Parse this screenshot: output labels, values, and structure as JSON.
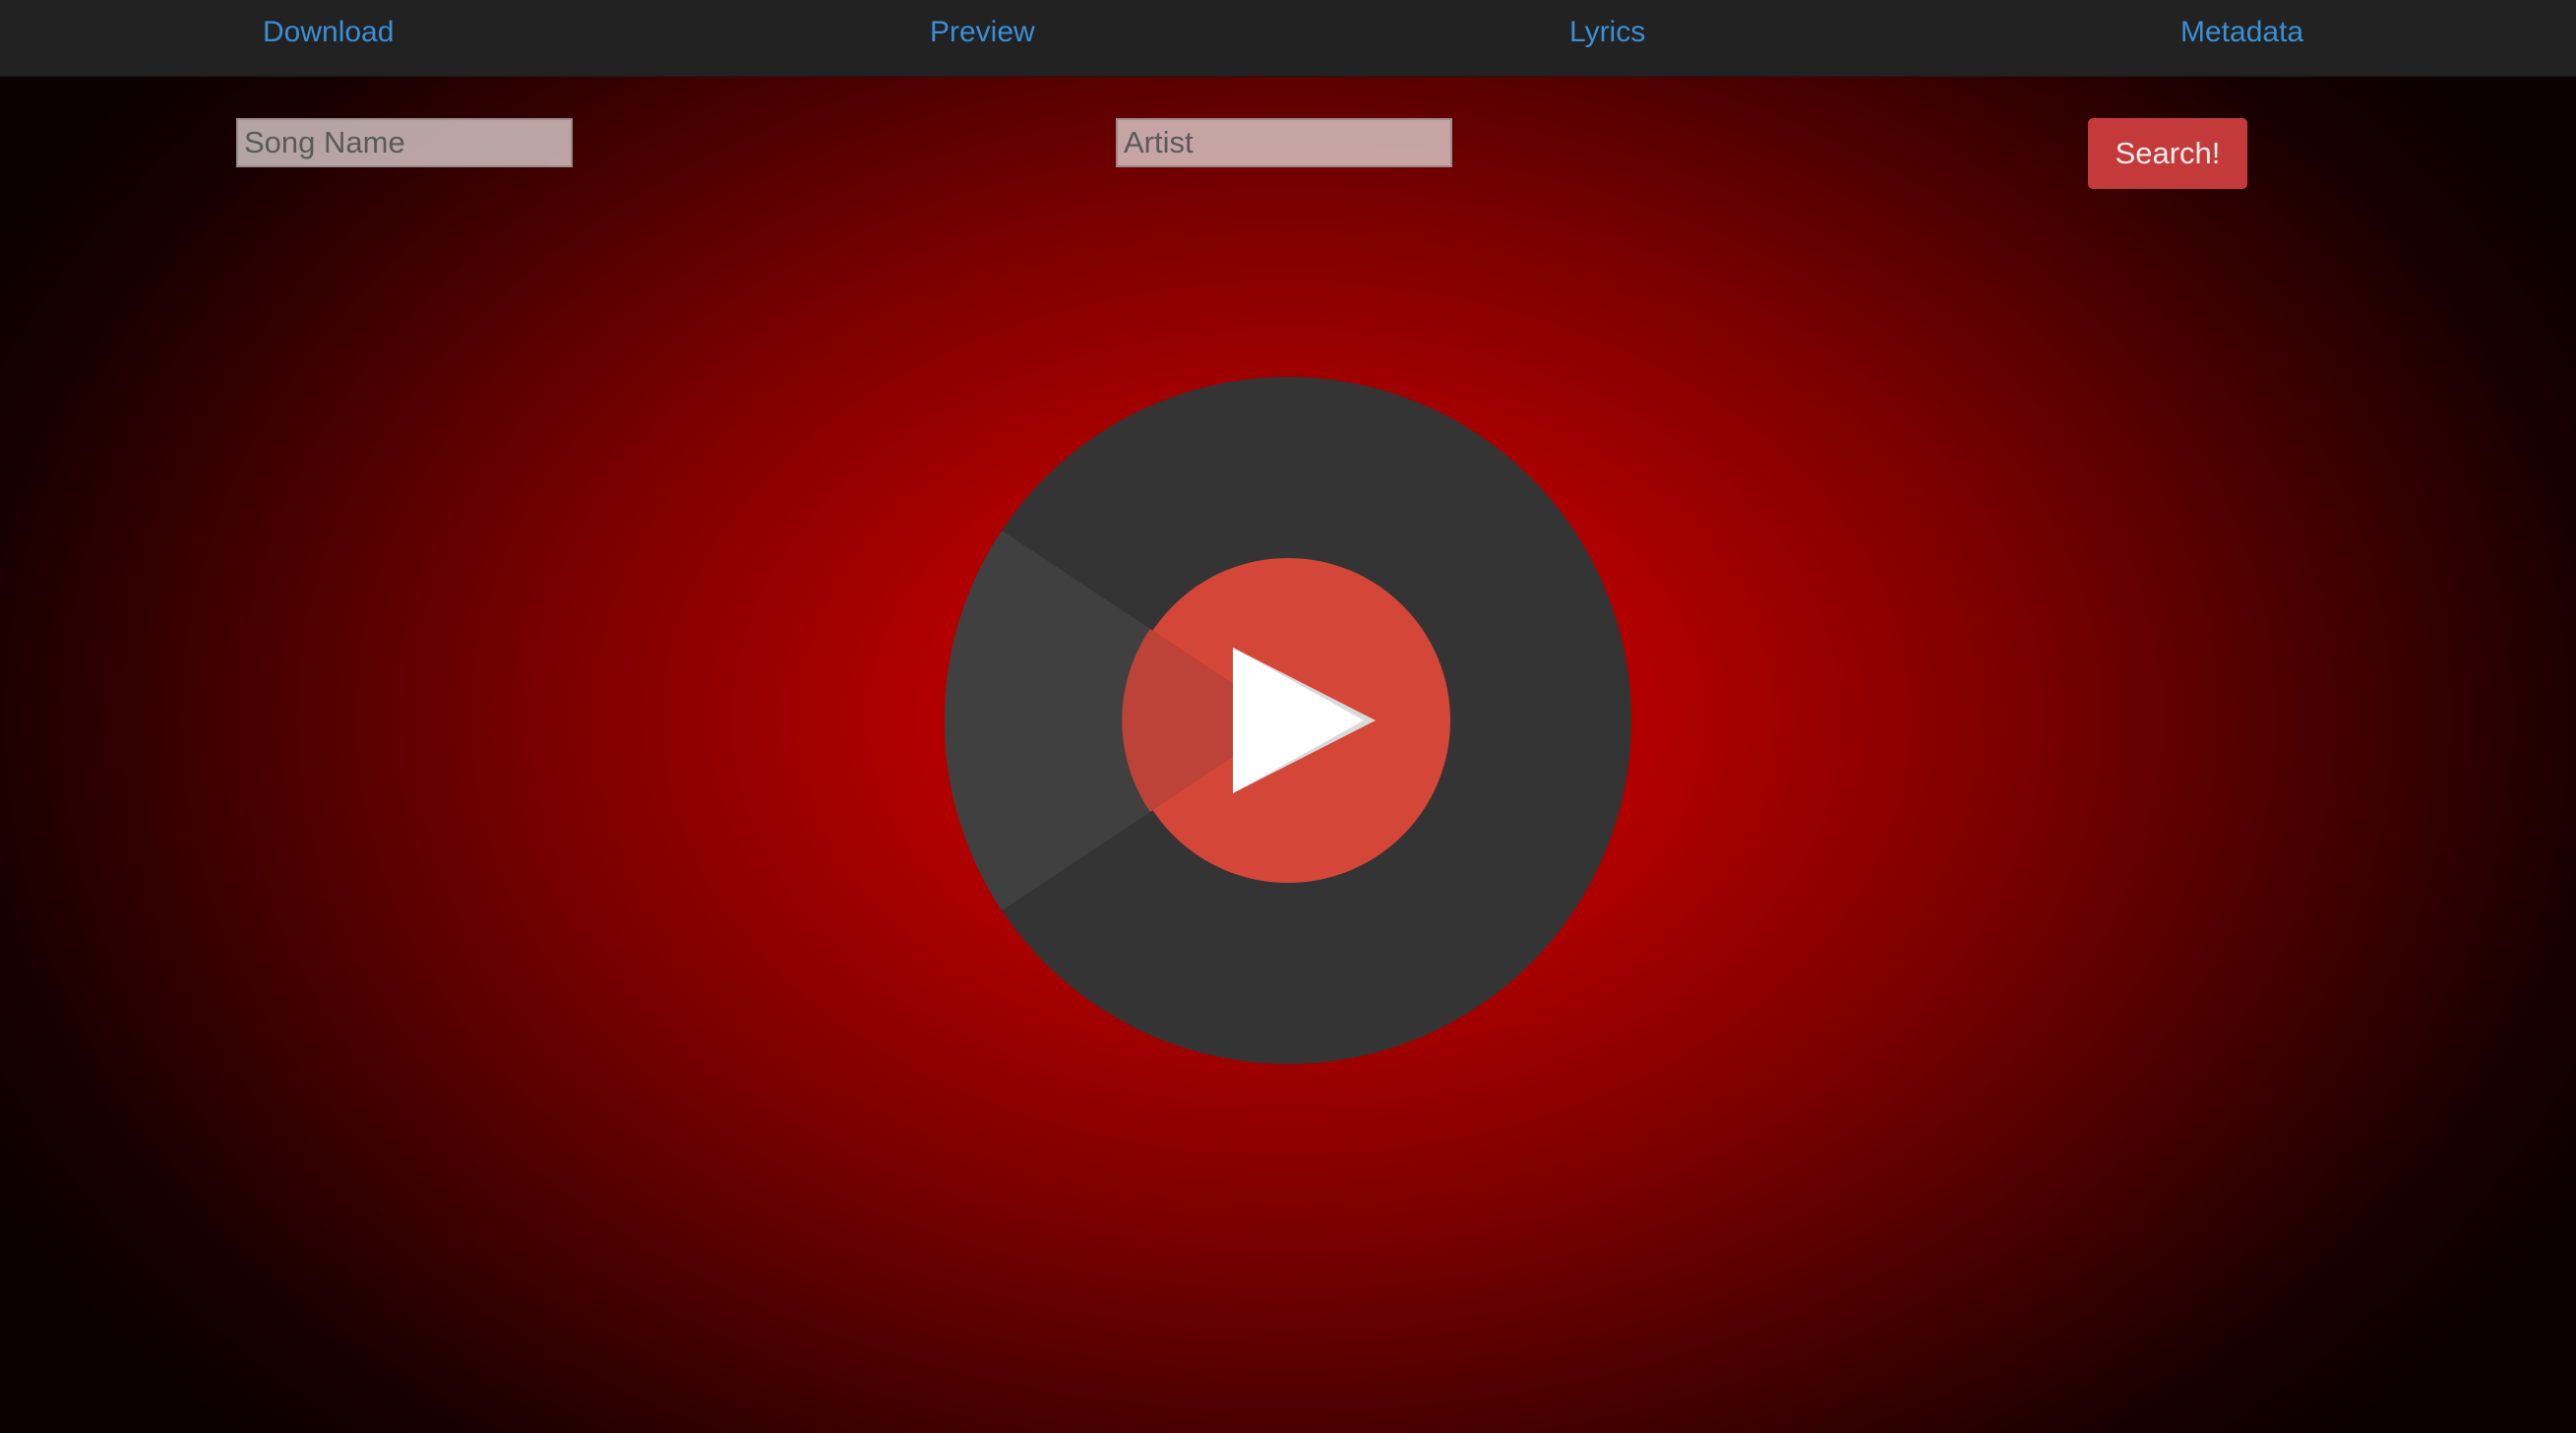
{
  "nav": {
    "items": [
      {
        "label": "Download"
      },
      {
        "label": "Preview"
      },
      {
        "label": "Lyrics"
      },
      {
        "label": "Metadata"
      }
    ]
  },
  "search": {
    "song_placeholder": "Song Name",
    "song_value": "",
    "artist_placeholder": "Artist",
    "artist_value": "",
    "button_label": "Search!"
  },
  "logo": {
    "icon": "music-play-logo-icon",
    "colors": {
      "disc": "#343434",
      "disc_highlight": "#404040",
      "center": "#d44638",
      "play": "#ffffff"
    }
  },
  "theme": {
    "nav_bg": "#222222",
    "link_color": "#3a8fd6",
    "button_bg": "#c43a3a",
    "background_center": "#cc0000"
  }
}
